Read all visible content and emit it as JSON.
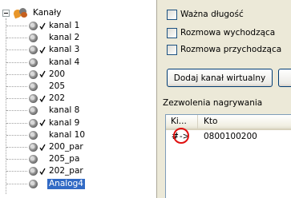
{
  "tree": {
    "root_label": "Kanały",
    "items": [
      {
        "label": "kanal 1",
        "checked": true
      },
      {
        "label": "kanal 2",
        "checked": false
      },
      {
        "label": "kanal 3",
        "checked": true
      },
      {
        "label": "kanal 4",
        "checked": false
      },
      {
        "label": "200",
        "checked": true
      },
      {
        "label": "205",
        "checked": false
      },
      {
        "label": "202",
        "checked": true
      },
      {
        "label": "kanal 8",
        "checked": false
      },
      {
        "label": "kanal 9",
        "checked": true
      },
      {
        "label": "kanal 10",
        "checked": false
      },
      {
        "label": "200_par",
        "checked": true
      },
      {
        "label": "205_pa",
        "checked": false
      },
      {
        "label": "202_par",
        "checked": true
      },
      {
        "label": "Analog4",
        "checked": false,
        "selected": true
      }
    ]
  },
  "panel": {
    "checkboxes": [
      {
        "label": "Ważna długość",
        "checked": false
      },
      {
        "label": "Rozmowa wychodząca",
        "checked": false
      },
      {
        "label": "Rozmowa przychodząca",
        "checked": false
      }
    ],
    "add_virtual_button": "Dodaj kanał wirtualny",
    "permissions_label": "Zezwolenia nagrywania",
    "permissions_list": {
      "columns": [
        "Ki...",
        "Kto"
      ],
      "rows": [
        {
          "marker": "#",
          "arrow": "->",
          "who": "0800100200"
        }
      ]
    }
  },
  "colors": {
    "selection": "#316ac5",
    "highlight_circle": "#e01010",
    "panel_background": "#ece9d8"
  }
}
